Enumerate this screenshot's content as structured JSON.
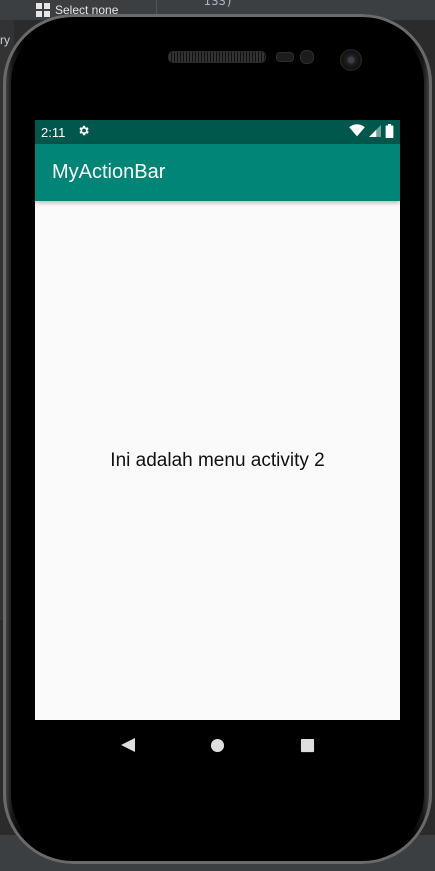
{
  "ide": {
    "select_none_label": "Select none",
    "left_fragment": "ry",
    "code_fragment": "ISS)",
    "code_paren": ")"
  },
  "phone": {
    "status_bar": {
      "time": "2:11",
      "settings_icon": "gear-icon",
      "wifi_icon": "wifi-icon",
      "signal_icon": "signal-icon",
      "battery_icon": "battery-icon",
      "background_color": "#00574b"
    },
    "action_bar": {
      "title": "MyActionBar",
      "background_color": "#008577"
    },
    "content": {
      "message": "Ini adalah menu activity 2"
    },
    "nav_bar": {
      "back_icon": "back-triangle-icon",
      "home_icon": "home-circle-icon",
      "recents_icon": "recents-square-icon"
    }
  }
}
